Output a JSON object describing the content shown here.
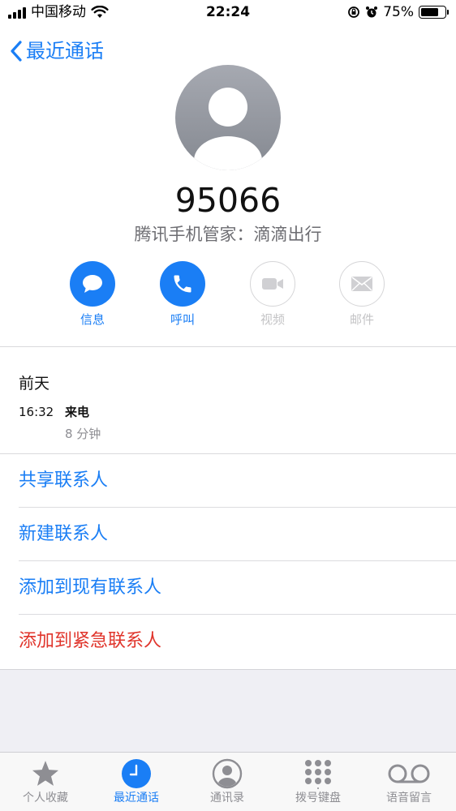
{
  "status_bar": {
    "carrier": "中国移动",
    "time": "22:24",
    "battery": "75%",
    "battery_level": 0.75
  },
  "nav": {
    "back_label": "最近通话"
  },
  "contact": {
    "number": "95066",
    "subtitle": "腾讯手机管家：滴滴出行"
  },
  "actions": [
    {
      "label": "信息",
      "icon": "message-icon",
      "enabled": true
    },
    {
      "label": "呼叫",
      "icon": "phone-icon",
      "enabled": true
    },
    {
      "label": "视频",
      "icon": "video-icon",
      "enabled": false
    },
    {
      "label": "邮件",
      "icon": "mail-icon",
      "enabled": false
    }
  ],
  "history": {
    "day": "前天",
    "time": "16:32",
    "type": "来电",
    "duration": "8 分钟"
  },
  "options": [
    {
      "label": "共享联系人"
    },
    {
      "label": "新建联系人"
    },
    {
      "label": "添加到现有联系人"
    },
    {
      "label": "添加到紧急联系人"
    }
  ],
  "tabs": [
    {
      "label": "个人收藏",
      "icon": "star-icon",
      "active": false
    },
    {
      "label": "最近通话",
      "icon": "clock-icon",
      "active": true
    },
    {
      "label": "通讯录",
      "icon": "contacts-icon",
      "active": false
    },
    {
      "label": "拨号键盘",
      "icon": "keypad-icon",
      "active": false
    },
    {
      "label": "语音留言",
      "icon": "voicemail-icon",
      "active": false
    }
  ],
  "colors": {
    "accent": "#1a7ef5",
    "danger": "#e0342b",
    "disabled": "#c4c4c6",
    "secondary_text": "#6d6d72"
  }
}
